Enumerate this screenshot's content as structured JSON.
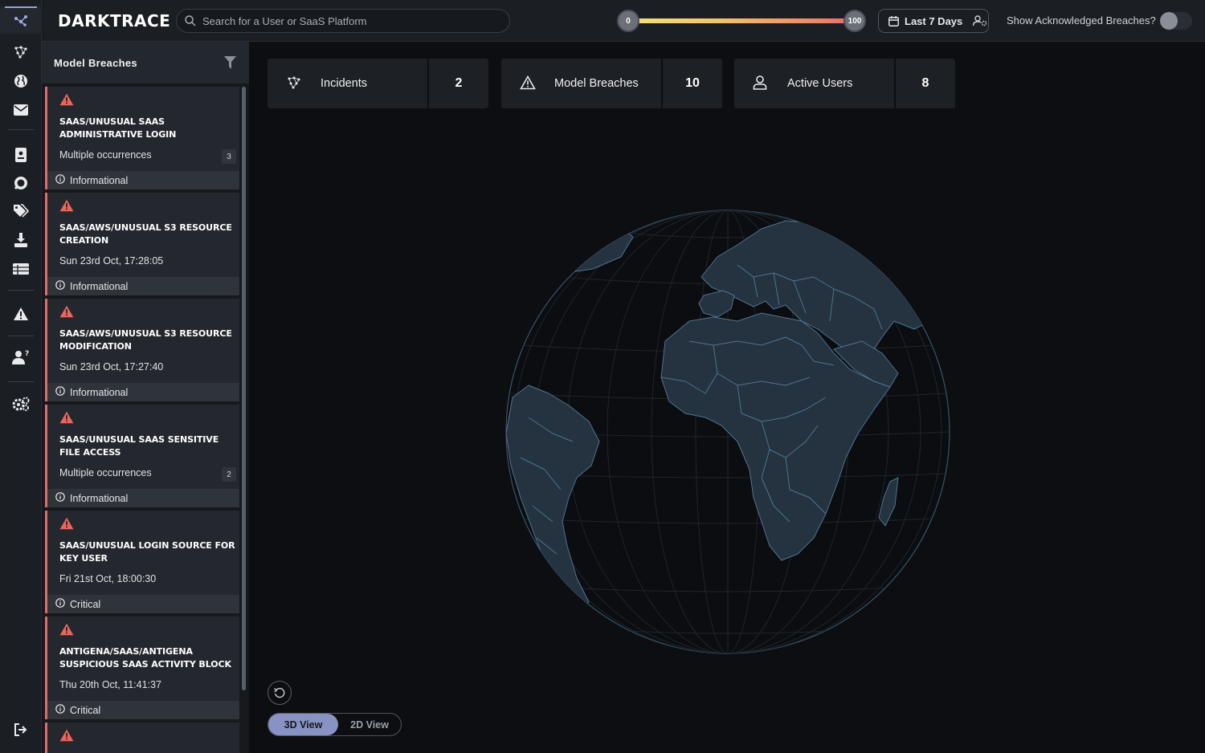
{
  "app": {
    "logo": "DARKTRACE"
  },
  "search": {
    "placeholder": "Search for a User or SaaS Platform"
  },
  "threat_slider": {
    "min_label": "0",
    "max_label": "100"
  },
  "date_range": {
    "label": "Last 7 Days"
  },
  "acknowledged": {
    "label": "Show Acknowledged Breaches?",
    "enabled": false
  },
  "panel": {
    "title": "Model Breaches"
  },
  "breaches": [
    {
      "title": "SAAS/UNUSUAL SAAS ADMINISTRATIVE LOGIN",
      "detail": "Multiple occurrences",
      "count": "3",
      "severity": "Informational"
    },
    {
      "title": "SAAS/AWS/UNUSUAL S3 RESOURCE CREATION",
      "detail": "Sun 23rd Oct, 17:28:05",
      "count": "",
      "severity": "Informational"
    },
    {
      "title": "SAAS/AWS/UNUSUAL S3 RESOURCE MODIFICATION",
      "detail": "Sun 23rd Oct, 17:27:40",
      "count": "",
      "severity": "Informational"
    },
    {
      "title": "SAAS/UNUSUAL SAAS SENSITIVE FILE ACCESS",
      "detail": "Multiple occurrences",
      "count": "2",
      "severity": "Informational"
    },
    {
      "title": "SAAS/UNUSUAL LOGIN SOURCE FOR KEY USER",
      "detail": "Fri 21st Oct, 18:00:30",
      "count": "",
      "severity": "Critical"
    },
    {
      "title": "ANTIGENA/SAAS/ANTIGENA SUSPICIOUS SAAS ACTIVITY BLOCK",
      "detail": "Thu 20th Oct, 11:41:37",
      "count": "",
      "severity": "Critical"
    }
  ],
  "stats": [
    {
      "label": "Incidents",
      "value": "2",
      "icon": "incidents-icon"
    },
    {
      "label": "Model Breaches",
      "value": "10",
      "icon": "warning-triangle-icon"
    },
    {
      "label": "Active Users",
      "value": "8",
      "icon": "user-icon"
    }
  ],
  "view_toggle": {
    "view_3d": "3D View",
    "view_2d": "2D View",
    "selected": "3D View"
  },
  "colors": {
    "accent": "#8893c4",
    "breach_border": "#e06b6b",
    "warning_icon": "#f0655a",
    "globe_land": "#25323f",
    "globe_border": "#4f7590"
  },
  "rail_icons": [
    "network-icon",
    "incidents-icon",
    "globe-icon",
    "mail-icon",
    "report-icon",
    "chat-icon",
    "tags-icon",
    "download-icon",
    "table-icon",
    "alert-icon",
    "user-question-icon",
    "settings-icon",
    "logout-icon"
  ]
}
